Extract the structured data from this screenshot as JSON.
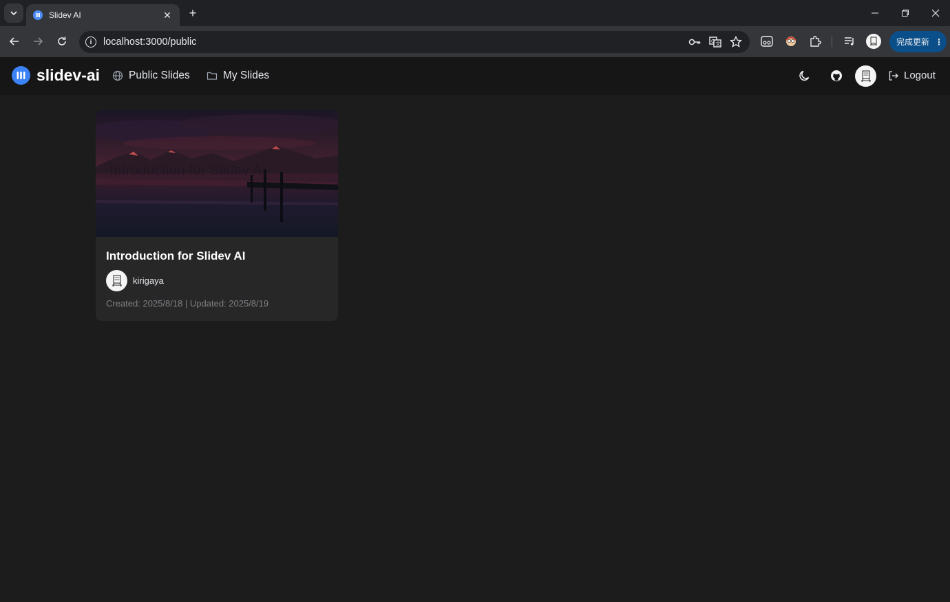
{
  "browser": {
    "tab_title": "Slidev AI",
    "url": "localhost:3000/public",
    "update_label": "完成更新"
  },
  "header": {
    "brand": "slidev-ai",
    "nav": [
      {
        "label": "Public Slides",
        "icon": "globe-icon"
      },
      {
        "label": "My Slides",
        "icon": "folder-icon"
      }
    ],
    "logout_label": "Logout"
  },
  "slides": [
    {
      "thumbnail_text": "Introduction for Slidev AI",
      "title": "Introduction for Slidev AI",
      "author": "kirigaya",
      "dates": "Created: 2025/8/18 | Updated: 2025/8/19"
    }
  ],
  "colors": {
    "page_bg": "#1c1c1d",
    "header_bg": "#161617",
    "card_bg": "#272728",
    "brand_blue": "#3b82f6",
    "update_btn": "#0b4f8a"
  }
}
